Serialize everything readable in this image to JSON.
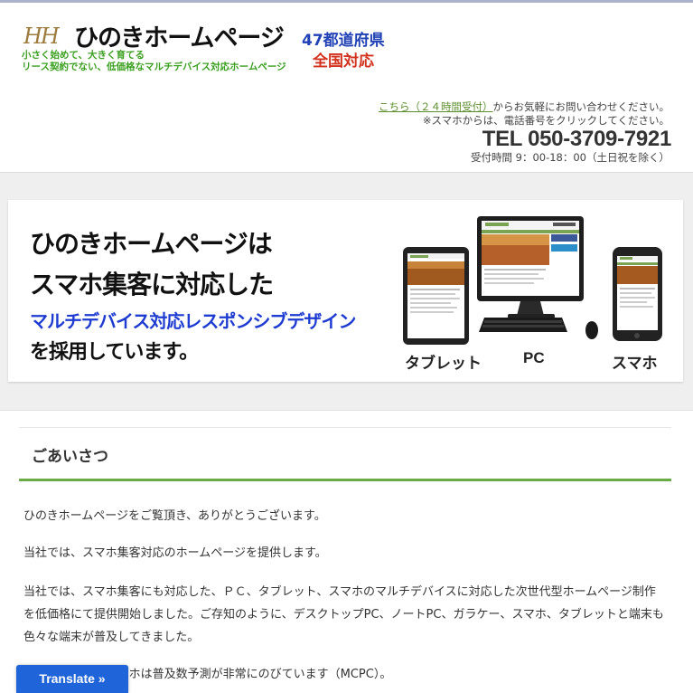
{
  "header": {
    "logo_mark": "HH",
    "site_title": "ひのきホームページ",
    "tagline_1": "小さく始めて、大きく育てる",
    "tagline_2": "リース契約でない、低価格なマルチデバイス対応ホームページ",
    "prefectures": "47都道府県",
    "nationwide": "全国対応",
    "contact_link": "こちら（２４時間受付）",
    "contact_text": "からお気軽にお問い合わせください。",
    "smartphone_note": "※スマホからは、電話番号をクリックしてください。",
    "tel": "TEL 050-3709-7921",
    "hours": "受付時間 9：00-18：00（土日祝を除く）"
  },
  "banner": {
    "line_1": "ひのきホームページは",
    "line_2": "スマホ集客に対応した",
    "line_3": "マルチデバイス対応レスポンシブデザイン",
    "line_4": "を採用しています。",
    "devices": [
      {
        "label": "タブレット"
      },
      {
        "label": "PC"
      },
      {
        "label": "スマホ"
      }
    ]
  },
  "greeting": {
    "title": "ごあいさつ",
    "paragraph_1": "ひのきホームページをご覧頂き、ありがとうございます。",
    "paragraph_2": "当社では、スマホ集客対応のホームページを提供します。",
    "paragraph_3": "当社では、スマホ集客にも対応した、ＰＣ、タブレット、スマホのマルチデバイスに対応した次世代型ホームページ制作を低価格にて提供開始しました。ご存知のように、デスクトップPC、ノートPC、ガラケー、スマホ、タブレットと端末も色々な端末が普及してきました。",
    "paragraph_4": "　　　　　　のスマホは普及数予測が非常にのびています（MCPC）。"
  },
  "translate_button": "Translate »",
  "colors": {
    "accent_green": "#6aab45",
    "title_blue": "#1e3cd1",
    "nationwide_red": "#d2321d",
    "translate_blue": "#1f64d8"
  }
}
